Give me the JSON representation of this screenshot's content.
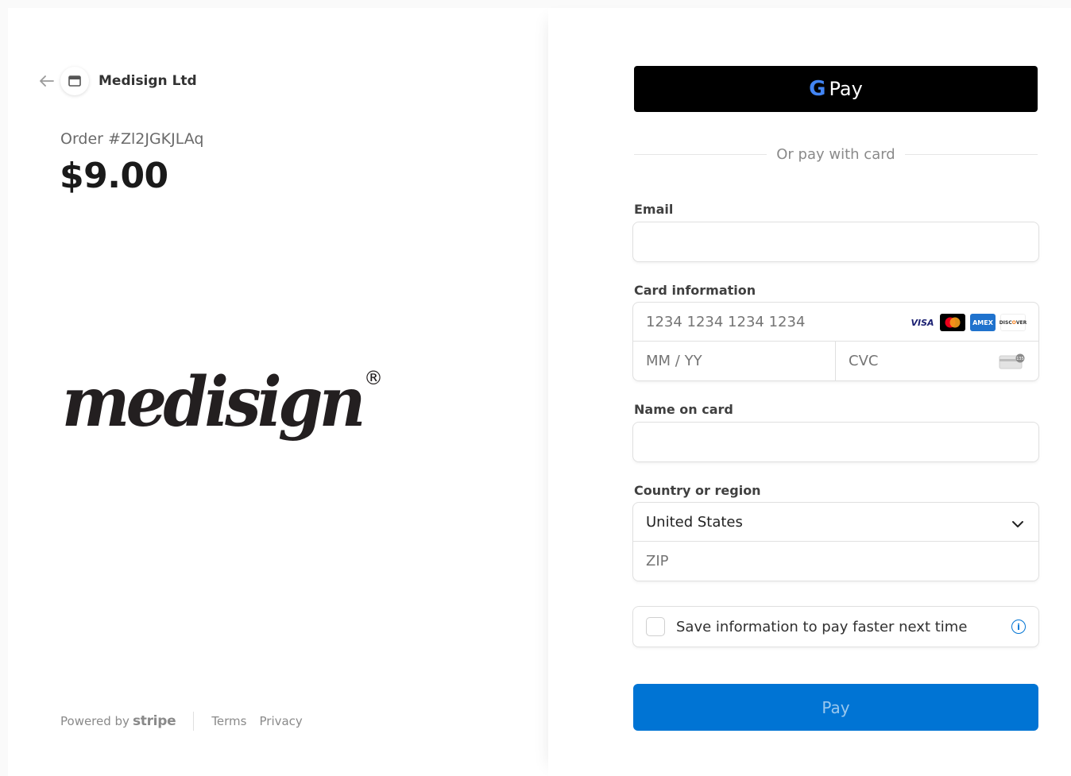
{
  "merchant": {
    "name": "Medisign Ltd",
    "logo_text": "medisign",
    "logo_mark": "®"
  },
  "order": {
    "label": "Order #Zl2JGKJLAq",
    "amount": "$9.00"
  },
  "footer": {
    "powered_by": "Powered by",
    "stripe": "stripe",
    "terms": "Terms",
    "privacy": "Privacy"
  },
  "gpay": {
    "g": "G",
    "label": "Pay"
  },
  "divider": {
    "text": "Or pay with card"
  },
  "email": {
    "label": "Email",
    "value": ""
  },
  "card": {
    "label": "Card information",
    "number_placeholder": "1234 1234 1234 1234",
    "expiry_placeholder": "MM / YY",
    "cvc_placeholder": "CVC",
    "brands": [
      "visa-icon",
      "mastercard-icon",
      "amex-icon",
      "discover-icon"
    ]
  },
  "name_on_card": {
    "label": "Name on card",
    "value": ""
  },
  "country": {
    "label": "Country or region",
    "selected": "United States",
    "zip_placeholder": "ZIP"
  },
  "save": {
    "label": "Save information to pay faster next time",
    "checked": false
  },
  "pay_button": {
    "label": "Pay"
  },
  "colors": {
    "accent": "#0074d4",
    "gpay_bg": "#000000",
    "logo": "#231f20"
  }
}
